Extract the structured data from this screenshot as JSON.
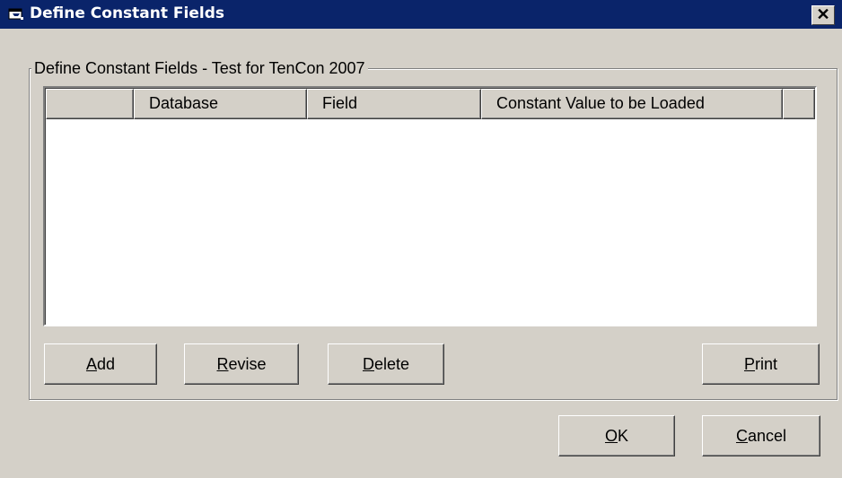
{
  "window": {
    "title": "Define Constant Fields",
    "close_glyph": "✕"
  },
  "group": {
    "legend": "Define Constant Fields - Test for TenCon 2007"
  },
  "list": {
    "columns": [
      "",
      "Database",
      "Field",
      "Constant Value to be Loaded",
      ""
    ],
    "rows": []
  },
  "buttons": {
    "add": {
      "accel": "A",
      "rest": "dd"
    },
    "revise": {
      "accel": "R",
      "rest": "evise"
    },
    "delete": {
      "accel": "D",
      "rest": "elete"
    },
    "print": {
      "accel": "P",
      "rest": "rint"
    },
    "ok": {
      "accel": "O",
      "rest": "K"
    },
    "cancel": {
      "accel": "C",
      "rest": "ancel"
    }
  },
  "icons": {
    "title_icon": "window-app-icon",
    "close_icon": "close-icon"
  },
  "colors": {
    "titlebar": "#0a246a",
    "face": "#d4d0c8",
    "list_bg": "#ffffff"
  }
}
